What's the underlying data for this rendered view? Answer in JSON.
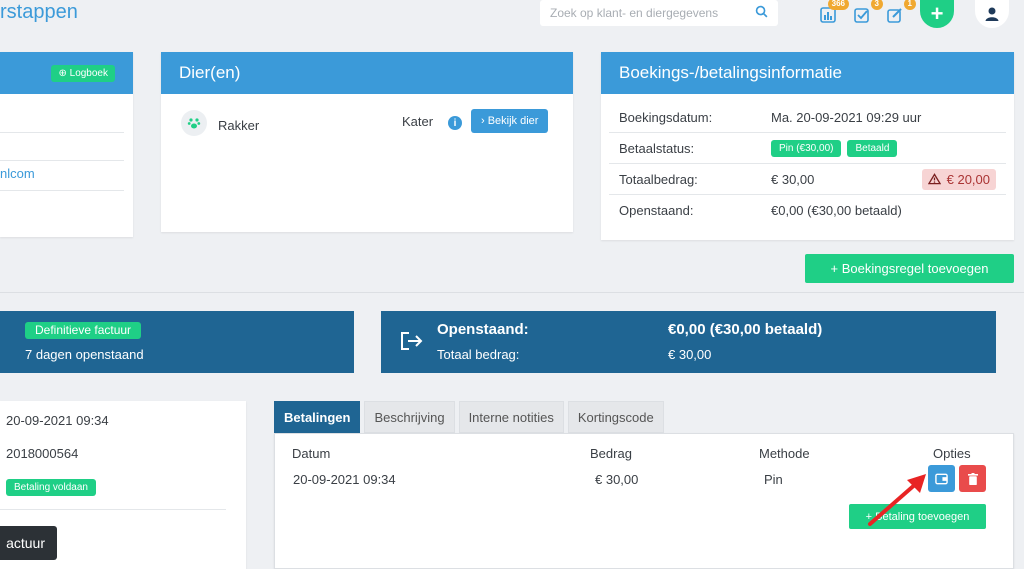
{
  "header": {
    "title": "rstappen",
    "search_placeholder": "Zoek op klant- en diergegevens",
    "badges": {
      "stats": "366",
      "tasks": "3",
      "notes": "1"
    },
    "icons": [
      "search-icon",
      "bar-chart-icon",
      "checkbox-icon",
      "edit-icon",
      "plus-icon",
      "user-icon"
    ]
  },
  "left_card": {
    "logbook_label": "⊕ Logboek",
    "email_fragment": "nlcom"
  },
  "animals": {
    "title": "Dier(en)",
    "name": "Rakker",
    "type": "Kater",
    "view_button": "› Bekijk dier"
  },
  "booking": {
    "title": "Boekings-/betalingsinformatie",
    "rows": {
      "date_label": "Boekingsdatum:",
      "date_value": "Ma. 20-09-2021 09:29 uur",
      "status_label": "Betaalstatus:",
      "status_method": "Pin (€30,00)",
      "status_paid": "Betaald",
      "total_label": "Totaalbedrag:",
      "total_value": "€ 30,00",
      "total_warning": "€ 20,00",
      "open_label": "Openstaand:",
      "open_value": "€0,00 (€30,00 betaald)"
    },
    "add_line_button": "+ Boekingsregel toevoegen"
  },
  "invoice_panel": {
    "badge": "Definitieve factuur",
    "days_open": "7 dagen openstaand"
  },
  "outstanding_panel": {
    "open_label": "Openstaand:",
    "open_value": "€0,00 (€30,00 betaald)",
    "total_label": "Totaal bedrag:",
    "total_value": "€ 30,00"
  },
  "invoice_details": {
    "date": "20-09-2021 09:34",
    "number": "2018000564",
    "status": "Betaling voldaan",
    "button": "actuur"
  },
  "tabs": [
    "Betalingen",
    "Beschrijving",
    "Interne notities",
    "Kortingscode"
  ],
  "payments": {
    "columns": [
      "Datum",
      "Bedrag",
      "Methode",
      "Opties"
    ],
    "rows": [
      {
        "date": "20-09-2021 09:34",
        "amount": "€ 30,00",
        "method": "Pin"
      }
    ],
    "add_button": "+ Betaling toevoegen"
  },
  "colors": {
    "primary": "#3b9ad9",
    "dark": "#1f6593",
    "success": "#1fcf86",
    "danger": "#e94b4b",
    "arrow": "#e82424"
  }
}
